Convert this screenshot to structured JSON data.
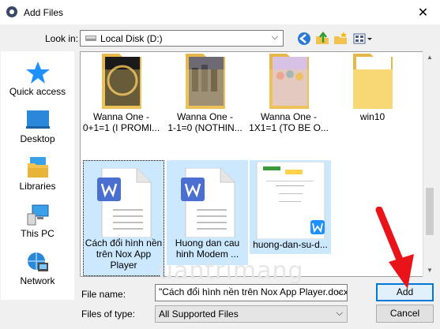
{
  "window": {
    "title": "Add Files",
    "close_glyph": "✕"
  },
  "lookin": {
    "label": "Look in:",
    "value": "Local Disk (D:)"
  },
  "toolbar": {
    "icons": [
      "back-icon",
      "up-folder-icon",
      "new-folder-icon",
      "view-menu-icon"
    ]
  },
  "places": [
    {
      "label": "Quick access",
      "icon": "quick-access-star-icon"
    },
    {
      "label": "Desktop",
      "icon": "desktop-icon"
    },
    {
      "label": "Libraries",
      "icon": "libraries-icon"
    },
    {
      "label": "This PC",
      "icon": "this-pc-icon"
    },
    {
      "label": "Network",
      "icon": "network-icon"
    }
  ],
  "files": [
    {
      "line1": "Wanna One -",
      "line2": "0+1=1 (I PROMI...",
      "type": "folder"
    },
    {
      "line1": "Wanna One -",
      "line2": "1-1=0 (NOTHIN...",
      "type": "folder"
    },
    {
      "line1": "Wanna One -",
      "line2": "1X1=1 (TO BE O...",
      "type": "folder"
    },
    {
      "line1": "win10",
      "line2": "",
      "type": "folder"
    },
    {
      "line1": "Cách đổi hình nền",
      "line2": "trên Nox App",
      "line3": "Player",
      "type": "docx",
      "selected": true
    },
    {
      "line1": "Huong dan cau",
      "line2": "hinh Modem ...",
      "type": "docx",
      "selected": true
    },
    {
      "line1": "huong-dan-su-d...",
      "line2": "",
      "type": "docx-thumb",
      "selected": true
    }
  ],
  "bottom": {
    "filename_label": "File name:",
    "filename_value": "\"Cách đổi hình nền trên Nox App Player.docx\"",
    "filetype_label": "Files of type:",
    "filetype_value": "All Supported Files",
    "add_label": "Add",
    "cancel_label": "Cancel"
  },
  "watermark": "uantrimang",
  "colors": {
    "accent": "#0078d7",
    "selection": "#cce8ff",
    "folder": "#f8d775",
    "wps": "#4a6fd0",
    "annotation_arrow": "#e8141a"
  }
}
